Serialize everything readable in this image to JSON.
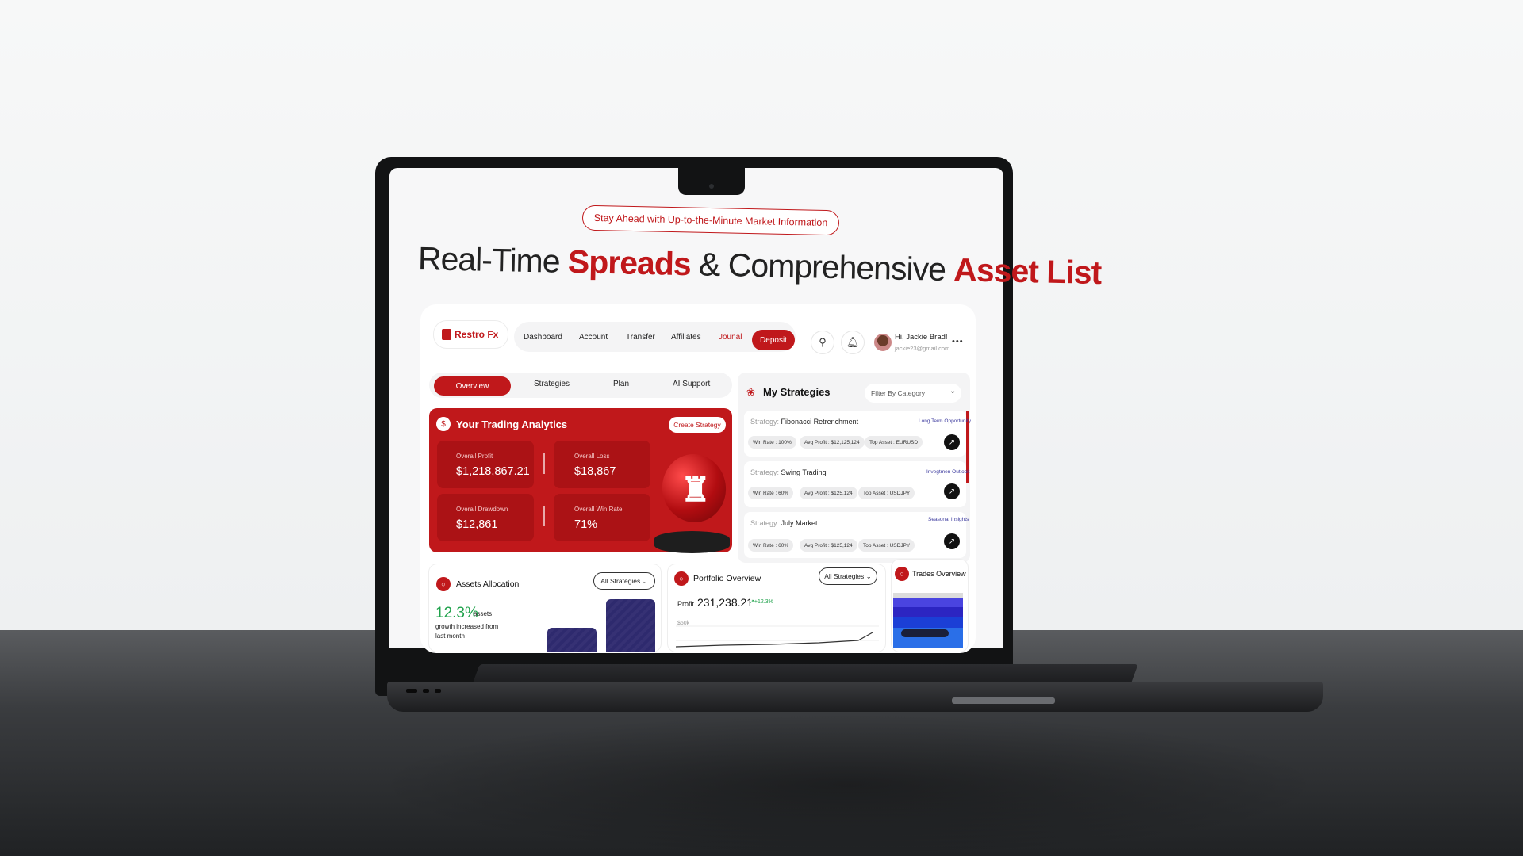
{
  "banner": "Stay Ahead with Up-to-the-Minute Market Information",
  "headline": {
    "part1": "Real-Time ",
    "part2": "Spreads",
    "part3": " & Comprehensive ",
    "part4": "Asset List"
  },
  "brand": {
    "name": "Restro Fx"
  },
  "nav": {
    "items": [
      "Dashboard",
      "Account",
      "Transfer",
      "Affiliates",
      "Jounal"
    ],
    "deposit": "Deposit"
  },
  "icons": {
    "search": "search-icon",
    "bell": "bell-icon",
    "more": "more-icon"
  },
  "user": {
    "greeting": "Hi, Jackie Brad!",
    "email": "jackie23@gmail.com"
  },
  "tabs": [
    "Overview",
    "Strategies",
    "Plan",
    "AI Support"
  ],
  "analytics": {
    "title": "Your Trading Analytics",
    "create_button": "Create Strategy",
    "stats": [
      {
        "label": "Overall Profit",
        "value": "$1,218,867.21"
      },
      {
        "label": "Overall Loss",
        "value": "$18,867"
      },
      {
        "label": "Overall Drawdown",
        "value": "$12,861"
      },
      {
        "label": "Overall Win Rate",
        "value": "71%"
      }
    ]
  },
  "strategies": {
    "title": "My Strategies",
    "filter": "Filter By Category",
    "prefix": "Strategy:",
    "items": [
      {
        "name": "Fibonacci Retrenchment",
        "tag": "Long Term Opportunity",
        "win": "Win Rate : 100%",
        "avg": "Avg Profit : $12,125,124",
        "top": "Top Asset : EURUSD"
      },
      {
        "name": "Swing Trading",
        "tag": "Invegtmen Outlook",
        "win": "Win Rate : 60%",
        "avg": "Avg Profit : $125,124",
        "top": "Top Asset : USDJPY"
      },
      {
        "name": "July Market",
        "tag": "Seasonal Insights",
        "win": "Win Rate : 60%",
        "avg": "Avg Profit : $125,124",
        "top": "Top Asset : USDJPY"
      }
    ]
  },
  "allocation": {
    "title": "Assets Allocation",
    "dropdown": "All Strategies",
    "percent": "12.3%",
    "percent_unit": "assets",
    "note": "growth increased from last month"
  },
  "portfolio": {
    "title": "Portfolio Overview",
    "dropdown": "All Strategies",
    "profit_label": "Profit",
    "profit_value": "231,238.21",
    "delta": "+12.3%",
    "tick": "$50k"
  },
  "trades": {
    "title": "Trades Overview"
  },
  "colors": {
    "brand_red": "#c0181b",
    "positive": "#1fa24b",
    "bar_navy": "#2e2a6e"
  }
}
